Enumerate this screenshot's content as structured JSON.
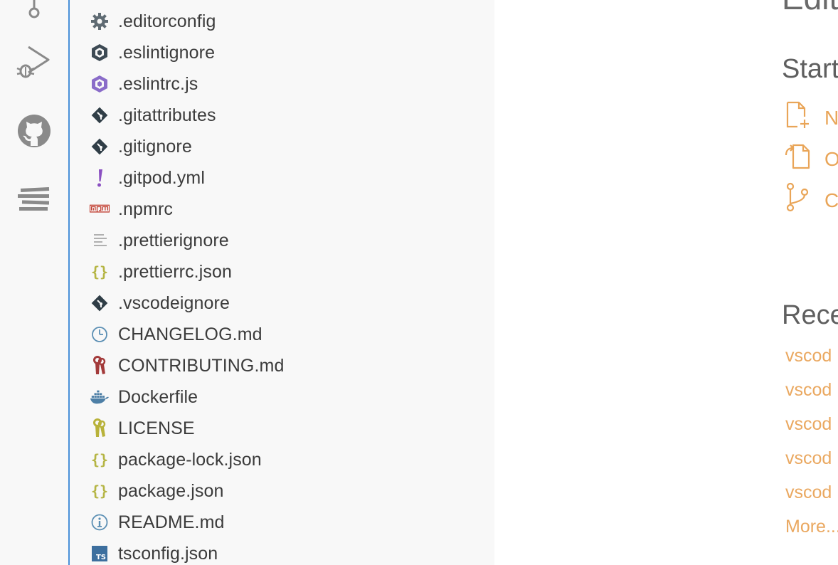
{
  "colors": {
    "sidebar_bg": "#f8f8f8",
    "focus_border": "#4a90d9",
    "link": "#eaa860",
    "text": "#3b3b3b"
  },
  "activity_bar": {
    "items": [
      {
        "name": "source-control",
        "icon": "source-control-icon"
      },
      {
        "name": "run-debug",
        "icon": "run-debug-icon"
      },
      {
        "name": "github",
        "icon": "github-icon"
      },
      {
        "name": "timeline",
        "icon": "timeline-icon"
      }
    ]
  },
  "explorer": {
    "files": [
      {
        "label": ".editorconfig",
        "icon": "gear-icon"
      },
      {
        "label": ".eslintignore",
        "icon": "eslint-icon"
      },
      {
        "label": ".eslintrc.js",
        "icon": "eslint-purple-icon"
      },
      {
        "label": ".gitattributes",
        "icon": "git-icon"
      },
      {
        "label": ".gitignore",
        "icon": "git-icon"
      },
      {
        "label": ".gitpod.yml",
        "icon": "exclamation-icon"
      },
      {
        "label": ".npmrc",
        "icon": "npm-icon"
      },
      {
        "label": ".prettierignore",
        "icon": "lines-icon"
      },
      {
        "label": ".prettierrc.json",
        "icon": "braces-icon"
      },
      {
        "label": ".vscodeignore",
        "icon": "git-icon"
      },
      {
        "label": "CHANGELOG.md",
        "icon": "clock-icon"
      },
      {
        "label": "CONTRIBUTING.md",
        "icon": "key-red-icon"
      },
      {
        "label": "Dockerfile",
        "icon": "docker-icon"
      },
      {
        "label": "LICENSE",
        "icon": "key-yellow-icon"
      },
      {
        "label": "package-lock.json",
        "icon": "braces-icon"
      },
      {
        "label": "package.json",
        "icon": "braces-icon"
      },
      {
        "label": "README.md",
        "icon": "info-icon"
      },
      {
        "label": "tsconfig.json",
        "icon": "typescript-icon"
      }
    ]
  },
  "editor": {
    "welcome_title": "Edit",
    "start": {
      "title": "Start",
      "items": [
        {
          "label": "N",
          "icon": "new-file-icon"
        },
        {
          "label": "O",
          "icon": "open-file-icon"
        },
        {
          "label": "C",
          "icon": "clone-repo-icon"
        }
      ]
    },
    "recent": {
      "title": "Rece",
      "items": [
        "vscod",
        "vscod",
        "vscod",
        "vscod",
        "vscod"
      ],
      "more_label": "More..."
    }
  }
}
